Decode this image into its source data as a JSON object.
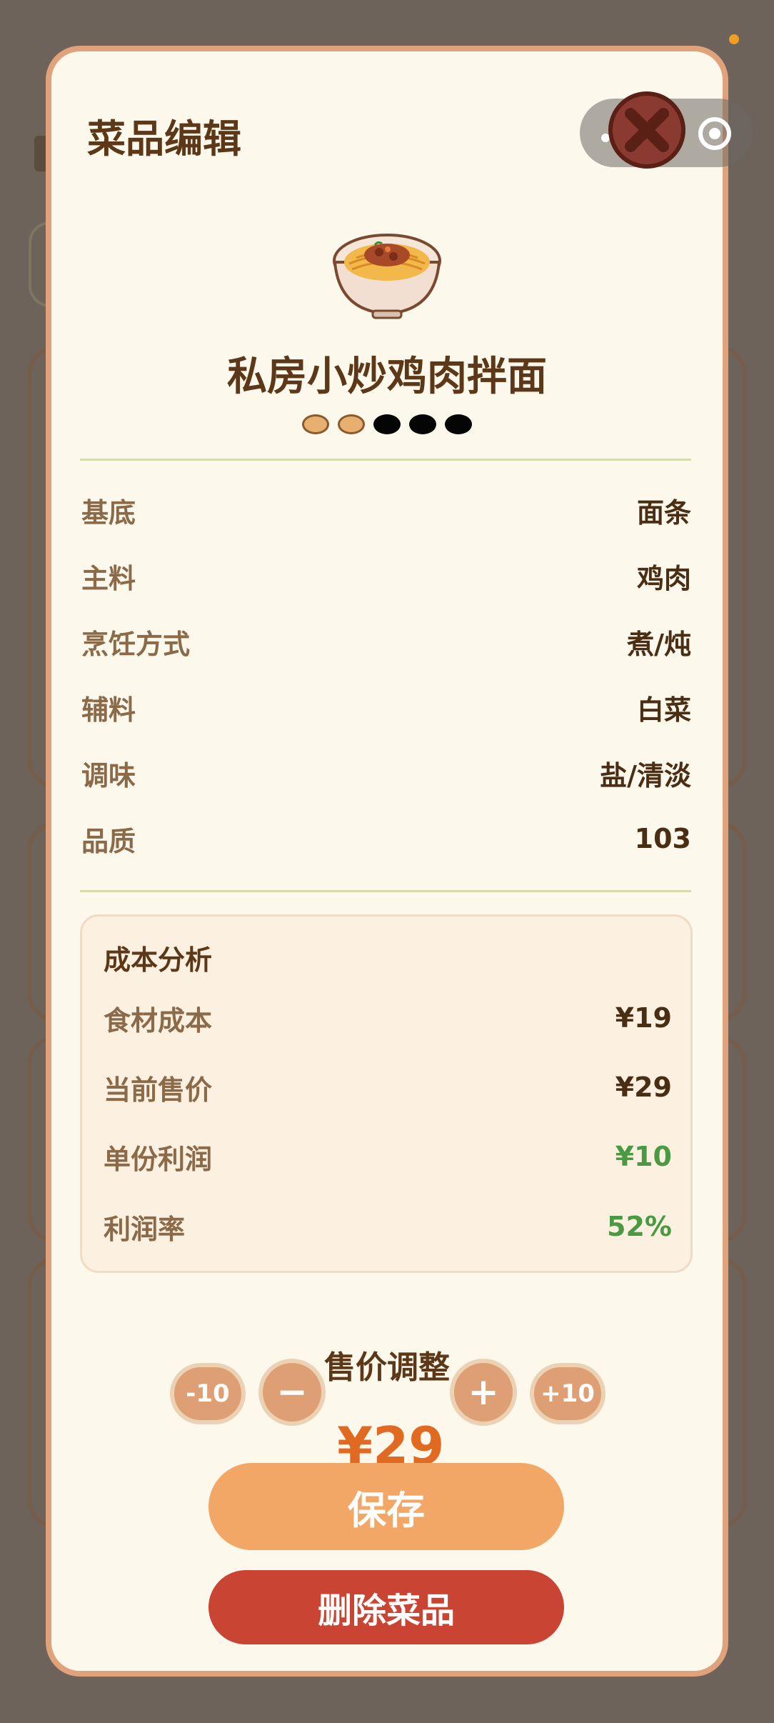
{
  "modal": {
    "title": "菜品编辑",
    "dish_name": "私房小炒鸡肉拌面",
    "dish_icon": "noodle-bowl-icon",
    "rating": {
      "filled": 2,
      "total": 5
    }
  },
  "details": [
    {
      "key": "基底",
      "value": "面条"
    },
    {
      "key": "主料",
      "value": "鸡肉"
    },
    {
      "key": "烹饪方式",
      "value": "煮/炖"
    },
    {
      "key": "辅料",
      "value": "白菜"
    },
    {
      "key": "调味",
      "value": "盐/清淡"
    },
    {
      "key": "品质",
      "value": "103"
    }
  ],
  "cost": {
    "title": "成本分析",
    "rows": [
      {
        "key": "食材成本",
        "value": "¥19"
      },
      {
        "key": "当前售价",
        "value": "¥29"
      },
      {
        "key": "单份利润",
        "value": "¥10"
      },
      {
        "key": "利润率",
        "value": "52%"
      }
    ]
  },
  "adjust": {
    "title": "售价调整",
    "minus10": "-10",
    "minus": "−",
    "price": "¥29",
    "plus": "+",
    "plus10": "+10"
  },
  "buttons": {
    "save": "保存",
    "delete": "删除菜品"
  },
  "colors": {
    "accent": "#e06a22",
    "save": "#f2a766",
    "delete": "#c94432",
    "profit": "#4a9a44"
  }
}
